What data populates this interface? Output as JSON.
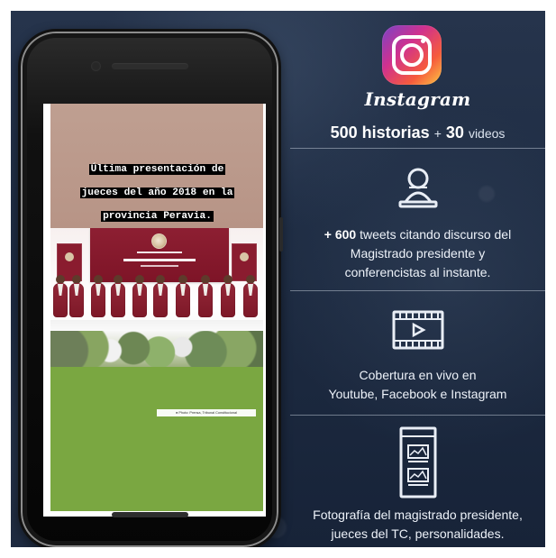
{
  "colors": {
    "background": "#1f2d44",
    "phone": "#111111",
    "instagram_gradient": [
      "#7a43c7",
      "#d0318e",
      "#f65b3c",
      "#fbc644"
    ],
    "story_top": "#bf9f91",
    "story_bottom": "#7aa741",
    "text": "#edf2f9"
  },
  "phone": {
    "caption_lines": [
      "Última presentación de",
      "jueces del año 2018 en la",
      "provincia Peravia."
    ],
    "photo_credit": "● Photo: Prensa, Tribunal Constitucional"
  },
  "sidebar": {
    "instagram_label": "Instagram",
    "stats": {
      "stories_value": "500",
      "stories_label": "historias",
      "plus": "+",
      "videos_value": "30",
      "videos_label": "videos"
    },
    "sections": [
      {
        "icon": "speaker-icon",
        "line1_prefix": "+ 600",
        "line1_suffix": " tweets citando discurso del",
        "line2": "Magistrado presidente y",
        "line3": "conferencistas al instante."
      },
      {
        "icon": "video-icon",
        "line1": "Cobertura en vivo en",
        "line2": "Youtube, Facebook e Instagram"
      },
      {
        "icon": "gallery-icon",
        "line1": "Fotografía del magistrado presidente,",
        "line2": "jueces del TC, personalidades."
      }
    ]
  }
}
